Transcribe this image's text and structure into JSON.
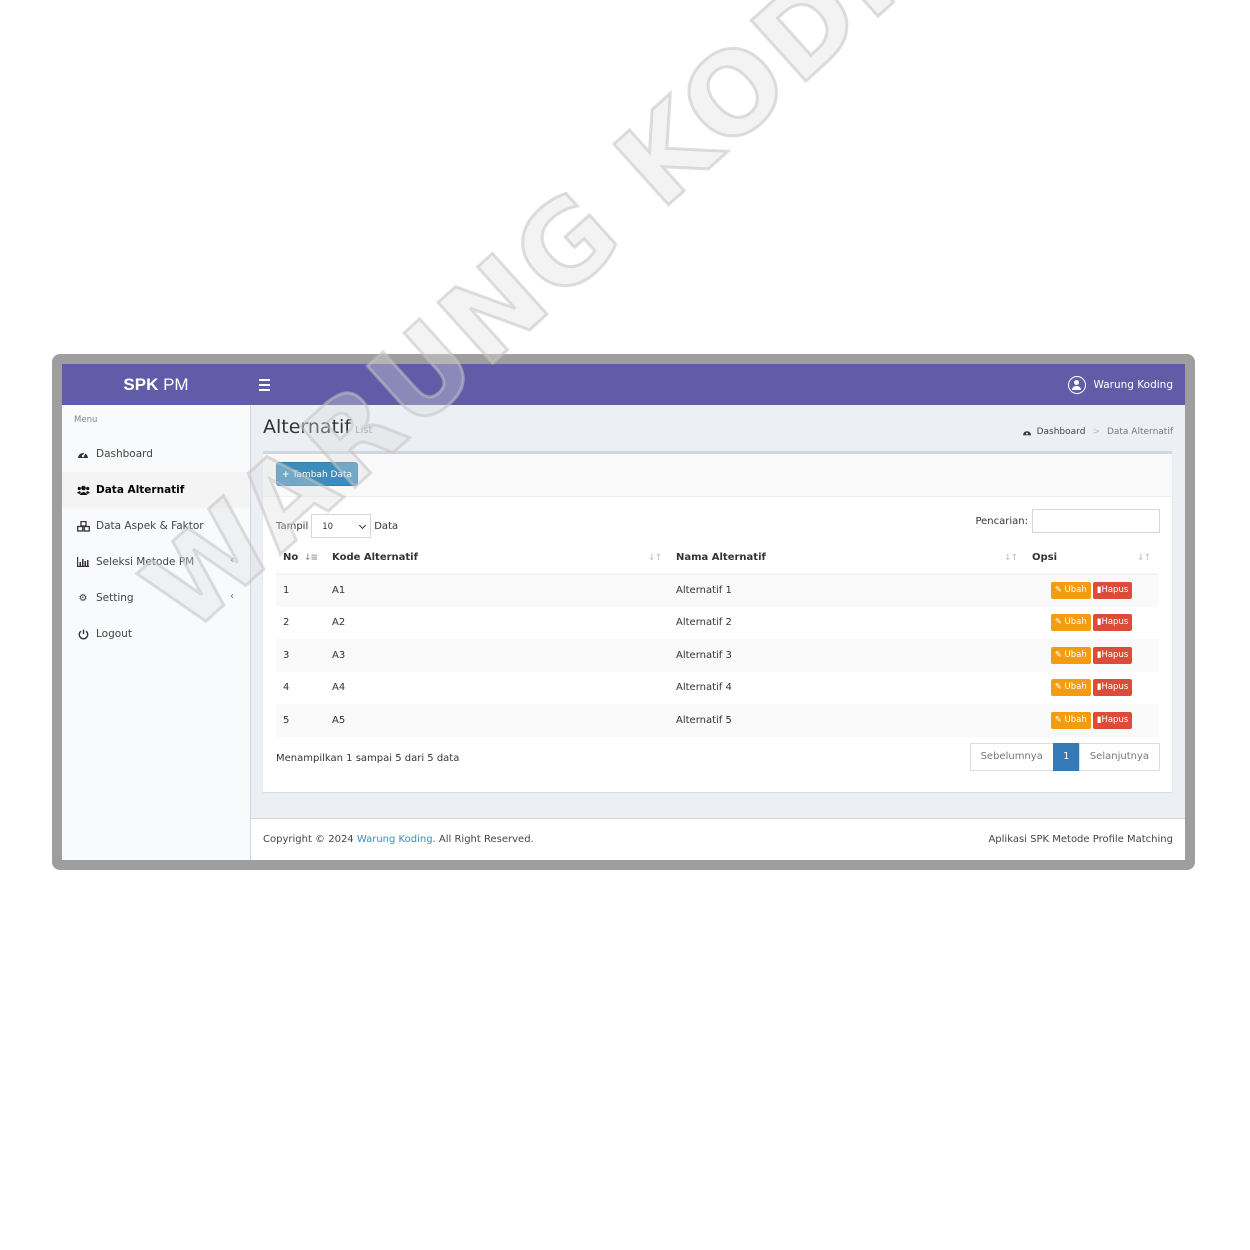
{
  "header": {
    "logo_bold": "SPK",
    "logo_light": "PM",
    "user_name": "Warung Koding"
  },
  "sidebar": {
    "menu_header": "Menu",
    "items": [
      {
        "label": "Dashboard",
        "icon": "dashboard-icon"
      },
      {
        "label": "Data Alternatif",
        "icon": "users-icon",
        "active": true
      },
      {
        "label": "Data Aspek & Faktor",
        "icon": "cubes-icon"
      },
      {
        "label": "Seleksi Metode PM",
        "icon": "bar-chart-icon"
      },
      {
        "label": "Setting",
        "icon": "gear-icon"
      },
      {
        "label": "Logout",
        "icon": "power-icon"
      }
    ]
  },
  "content": {
    "title": "Alternatif",
    "subtitle": "List",
    "breadcrumb": {
      "home": "Dashboard",
      "current": "Data Alternatif"
    },
    "add_button": "Tambah Data",
    "length_label_before": "Tampil",
    "length_value": "10",
    "length_label_after": "Data",
    "search_label": "Pencarian:",
    "table": {
      "columns": [
        "No",
        "Kode Alternatif",
        "Nama Alternatif",
        "Opsi"
      ],
      "rows": [
        {
          "no": "1",
          "kode": "A1",
          "nama": "Alternatif 1"
        },
        {
          "no": "2",
          "kode": "A2",
          "nama": "Alternatif 2"
        },
        {
          "no": "3",
          "kode": "A3",
          "nama": "Alternatif 3"
        },
        {
          "no": "4",
          "kode": "A4",
          "nama": "Alternatif 4"
        },
        {
          "no": "5",
          "kode": "A5",
          "nama": "Alternatif 5"
        }
      ],
      "edit_label": "Ubah",
      "delete_label": "Hapus"
    },
    "info": "Menampilkan 1 sampai 5 dari 5 data",
    "pagination": {
      "prev": "Sebelumnya",
      "current": "1",
      "next": "Selanjutnya"
    }
  },
  "footer": {
    "copyright_prefix": "Copyright © 2024",
    "copyright_link": "Warung Koding",
    "copyright_suffix": ". All Right Reserved.",
    "app_name": "Aplikasi SPK Metode Profile Matching"
  },
  "watermark": "WARUNG KODING",
  "colors": {
    "header": "#605ca8",
    "primary": "#3c8dbc",
    "warning": "#f39c12",
    "danger": "#dd4b39"
  }
}
